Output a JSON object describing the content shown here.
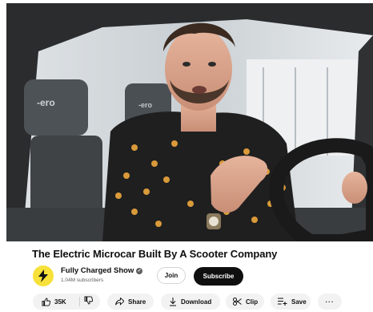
{
  "video": {
    "title": "The Electric Microcar Built By A Scooter Company",
    "thumbnail_text_left": "-ero",
    "thumbnail_text_right": "-ero"
  },
  "channel": {
    "name": "Fully Charged Show",
    "verified_icon": "checkmark-icon",
    "subscribers": "1.04M subscribers",
    "avatar_icon": "lightning-bolt-icon",
    "avatar_color": "#f7e13a"
  },
  "buttons": {
    "join": "Join",
    "subscribe": "Subscribe"
  },
  "actions": {
    "likes": "35K",
    "share": "Share",
    "download": "Download",
    "clip": "Clip",
    "save": "Save",
    "more": "···"
  },
  "colors": {
    "subscribe_bg": "#0f0f0f",
    "pill_bg": "#f2f2f2",
    "secondary_text": "#606060"
  }
}
